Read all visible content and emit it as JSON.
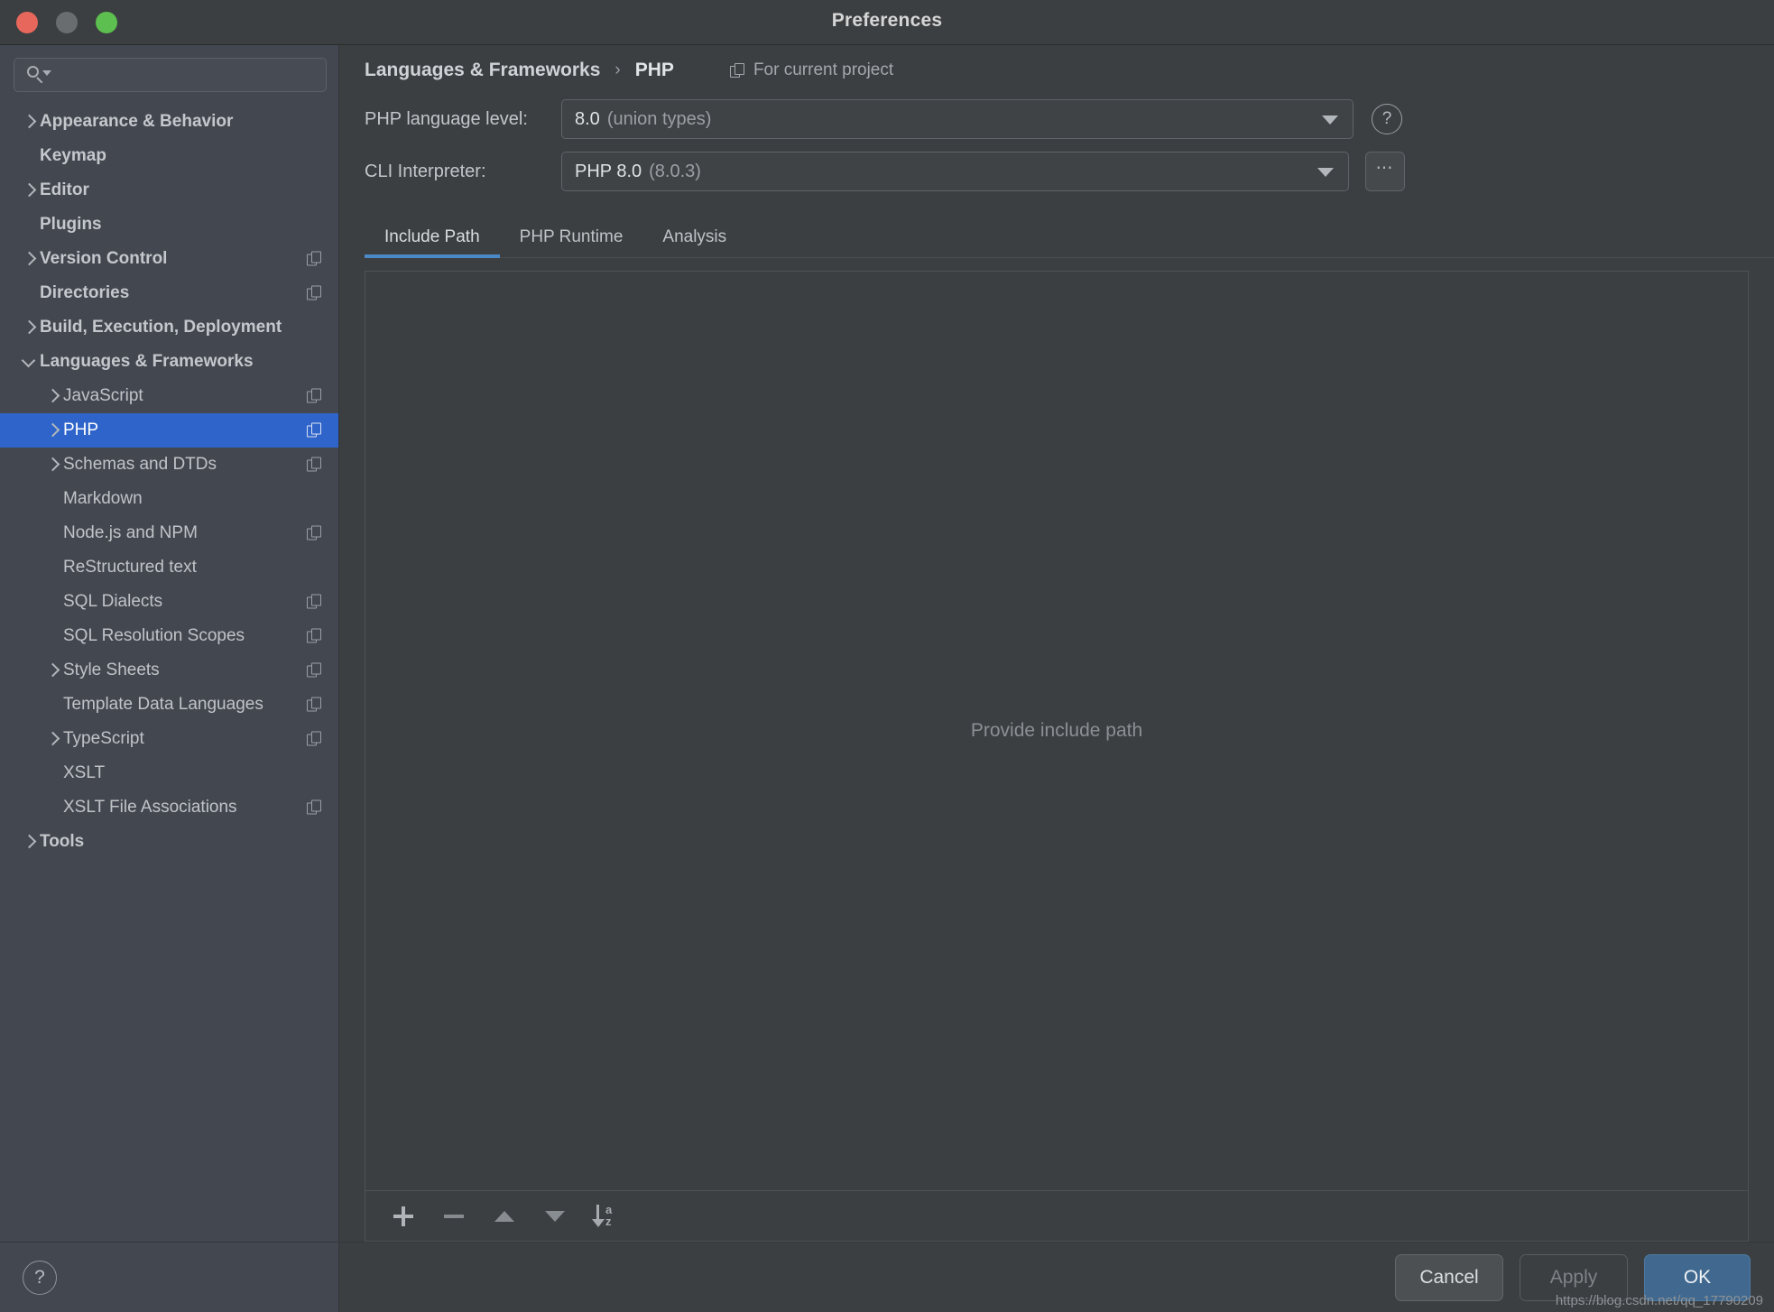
{
  "window": {
    "title": "Preferences",
    "traffic_lights": [
      "close-button",
      "minimize-button",
      "zoom-button"
    ]
  },
  "sidebar": {
    "search": {
      "value": "",
      "placeholder": ""
    },
    "help_label": "?",
    "items": [
      {
        "label": "Appearance & Behavior",
        "level": "top",
        "chevron": "right",
        "badge": false,
        "selected": false
      },
      {
        "label": "Keymap",
        "level": "top",
        "chevron": "none",
        "badge": false,
        "selected": false
      },
      {
        "label": "Editor",
        "level": "top",
        "chevron": "right",
        "badge": false,
        "selected": false
      },
      {
        "label": "Plugins",
        "level": "top",
        "chevron": "none",
        "badge": false,
        "selected": false
      },
      {
        "label": "Version Control",
        "level": "top",
        "chevron": "right",
        "badge": true,
        "selected": false
      },
      {
        "label": "Directories",
        "level": "top",
        "chevron": "none",
        "badge": true,
        "selected": false
      },
      {
        "label": "Build, Execution, Deployment",
        "level": "top",
        "chevron": "right",
        "badge": false,
        "selected": false
      },
      {
        "label": "Languages & Frameworks",
        "level": "top",
        "chevron": "down",
        "badge": false,
        "selected": false
      },
      {
        "label": "JavaScript",
        "level": "child",
        "chevron": "right",
        "badge": true,
        "selected": false
      },
      {
        "label": "PHP",
        "level": "child",
        "chevron": "right",
        "badge": true,
        "selected": true
      },
      {
        "label": "Schemas and DTDs",
        "level": "child",
        "chevron": "right",
        "badge": true,
        "selected": false
      },
      {
        "label": "Markdown",
        "level": "child",
        "chevron": "none",
        "badge": false,
        "selected": false
      },
      {
        "label": "Node.js and NPM",
        "level": "child",
        "chevron": "none",
        "badge": true,
        "selected": false
      },
      {
        "label": "ReStructured text",
        "level": "child",
        "chevron": "none",
        "badge": false,
        "selected": false
      },
      {
        "label": "SQL Dialects",
        "level": "child",
        "chevron": "none",
        "badge": true,
        "selected": false
      },
      {
        "label": "SQL Resolution Scopes",
        "level": "child",
        "chevron": "none",
        "badge": true,
        "selected": false
      },
      {
        "label": "Style Sheets",
        "level": "child",
        "chevron": "right",
        "badge": true,
        "selected": false
      },
      {
        "label": "Template Data Languages",
        "level": "child",
        "chevron": "none",
        "badge": true,
        "selected": false
      },
      {
        "label": "TypeScript",
        "level": "child",
        "chevron": "right",
        "badge": true,
        "selected": false
      },
      {
        "label": "XSLT",
        "level": "child",
        "chevron": "none",
        "badge": false,
        "selected": false
      },
      {
        "label": "XSLT File Associations",
        "level": "child",
        "chevron": "none",
        "badge": true,
        "selected": false
      },
      {
        "label": "Tools",
        "level": "top",
        "chevron": "right",
        "badge": false,
        "selected": false
      }
    ]
  },
  "main": {
    "breadcrumb": {
      "root": "Languages & Frameworks",
      "separator": "›",
      "leaf": "PHP"
    },
    "scope": {
      "label": "For current project"
    },
    "fields": [
      {
        "label": "PHP language level:",
        "value_main": "8.0",
        "value_dim": "(union types)"
      },
      {
        "label": "CLI Interpreter:",
        "value_main": "PHP 8.0",
        "value_dim": "(8.0.3)"
      }
    ],
    "help_label": "?",
    "dots_label": "⋯",
    "tabs": [
      {
        "label": "Include Path",
        "active": true
      },
      {
        "label": "PHP Runtime",
        "active": false
      },
      {
        "label": "Analysis",
        "active": false
      }
    ],
    "list_placeholder": "Provide include path",
    "toolbar": [
      {
        "name": "add-button",
        "icon": "plus-icon"
      },
      {
        "name": "remove-button",
        "icon": "minus-icon"
      },
      {
        "name": "move-up-button",
        "icon": "arrow-up-icon"
      },
      {
        "name": "move-down-button",
        "icon": "arrow-down-icon"
      },
      {
        "name": "sort-button",
        "icon": "sort-az-icon",
        "a": "a",
        "z": "z"
      }
    ]
  },
  "footer": {
    "cancel": "Cancel",
    "apply": "Apply",
    "ok": "OK",
    "watermark": "https://blog.csdn.net/qq_17790209"
  },
  "colors": {
    "accent": "#2f65ca",
    "tab_underline": "#4a88c7",
    "ok_button": "#41698f",
    "sidebar_bg": "#434750",
    "panel_bg": "#3c3f41"
  }
}
